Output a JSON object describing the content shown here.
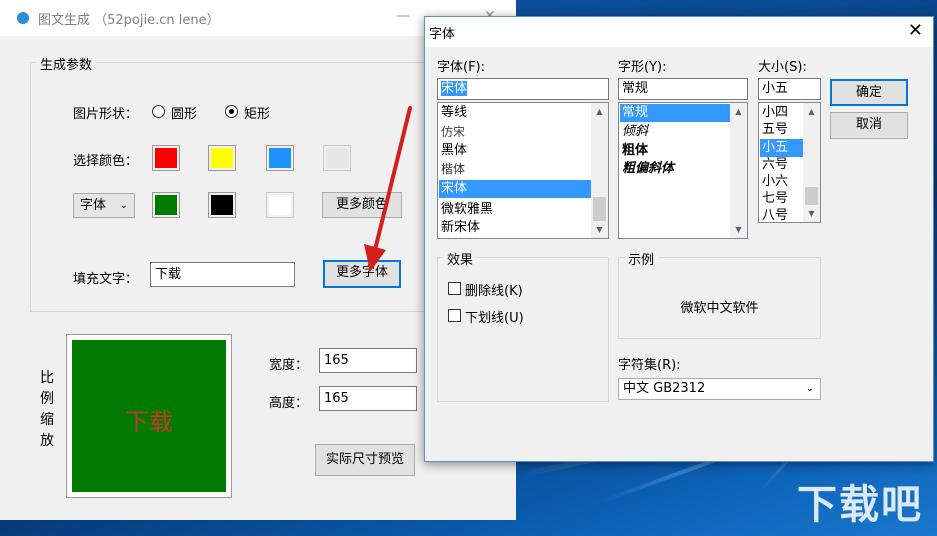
{
  "main_window": {
    "title": "图文生成 （52pojie.cn lene）",
    "minimize_glyph": "—",
    "close_glyph": "✕",
    "group_title": "生成参数",
    "shape_label": "图片形状：",
    "shape_options": [
      "圆形",
      "矩形"
    ],
    "shape_selected": "矩形",
    "color_label": "选择颜色：",
    "color_row1": [
      "#ff0000",
      "#ffff00",
      "#1e90ff",
      "#e6e6e6"
    ],
    "target_select": "字体",
    "color_row2": [
      "#007a00",
      "#000000",
      "#ffffff"
    ],
    "more_colors": "更多颜色",
    "fill_text_label": "填充文字：",
    "fill_text_value": "下载",
    "more_fonts": "更多字体",
    "scale_label": "比例缩放",
    "width_label": "宽度：",
    "width_value": "165",
    "height_label": "高度：",
    "height_value": "165",
    "preview_button": "实际尺寸预览",
    "preview_text": "下载",
    "preview_bg": "#007a00",
    "preview_text_color": "#c0392b"
  },
  "font_dialog": {
    "title": "字体",
    "close_glyph": "✕",
    "font_label": "字体(F):",
    "font_value": "宋体",
    "font_list": [
      "等线",
      "仿宋",
      "黑体",
      "楷体",
      "宋体",
      "微软雅黑",
      "新宋体"
    ],
    "font_selected": "宋体",
    "style_label": "字形(Y):",
    "style_value": "常规",
    "style_list": [
      "常规",
      "倾斜",
      "粗体",
      "粗偏斜体"
    ],
    "style_selected": "常规",
    "size_label": "大小(S):",
    "size_value": "小五",
    "size_list": [
      "小四",
      "五号",
      "小五",
      "六号",
      "小六",
      "七号",
      "八号"
    ],
    "size_selected": "小五",
    "ok_button": "确定",
    "cancel_button": "取消",
    "effects_title": "效果",
    "strikeout": "删除线(K)",
    "underline": "下划线(U)",
    "sample_title": "示例",
    "sample_text": "微软中文软件",
    "charset_label": "字符集(R):",
    "charset_value": "中文 GB2312"
  },
  "icons": {
    "scroll_up": "▲",
    "scroll_down": "▼",
    "combo_chevron": "⌄"
  },
  "watermark": "下载吧"
}
